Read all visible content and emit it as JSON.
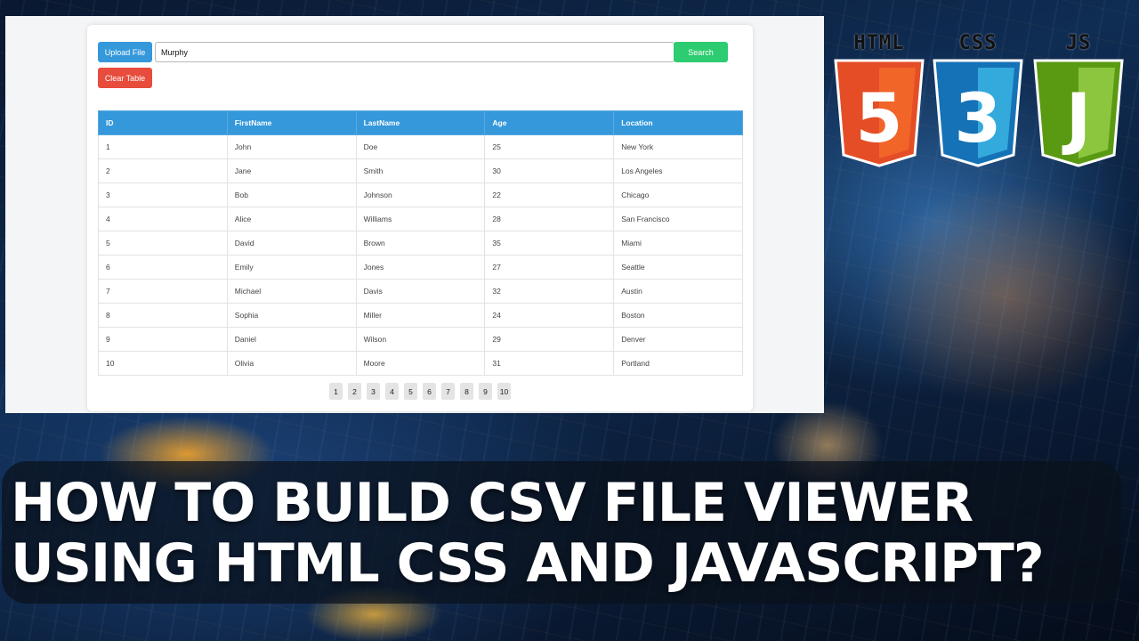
{
  "toolbar": {
    "upload_label": "Upload File",
    "clear_label": "Clear Table",
    "search_label": "Search",
    "search_value": "Murphy"
  },
  "table": {
    "headers": [
      "ID",
      "FirstName",
      "LastName",
      "Age",
      "Location"
    ],
    "rows": [
      [
        "1",
        "John",
        "Doe",
        "25",
        "New York"
      ],
      [
        "2",
        "Jane",
        "Smith",
        "30",
        "Los Angeles"
      ],
      [
        "3",
        "Bob",
        "Johnson",
        "22",
        "Chicago"
      ],
      [
        "4",
        "Alice",
        "Williams",
        "28",
        "San Francisco"
      ],
      [
        "5",
        "David",
        "Brown",
        "35",
        "Miami"
      ],
      [
        "6",
        "Emily",
        "Jones",
        "27",
        "Seattle"
      ],
      [
        "7",
        "Michael",
        "Davis",
        "32",
        "Austin"
      ],
      [
        "8",
        "Sophia",
        "Miller",
        "24",
        "Boston"
      ],
      [
        "9",
        "Daniel",
        "Wilson",
        "29",
        "Denver"
      ],
      [
        "10",
        "Olivia",
        "Moore",
        "31",
        "Portland"
      ]
    ]
  },
  "pagination": {
    "pages": [
      "1",
      "2",
      "3",
      "4",
      "5",
      "6",
      "7",
      "8",
      "9",
      "10"
    ]
  },
  "logos": {
    "html": {
      "label": "HTML",
      "numeral": "5",
      "icon": "html5-shield-icon",
      "color": "#e44d26"
    },
    "css": {
      "label": "CSS",
      "numeral": "3",
      "icon": "css3-shield-icon",
      "color": "#1572b6"
    },
    "js": {
      "label": "JS",
      "numeral": "J",
      "icon": "js-shield-icon",
      "color": "#6aaa1a"
    }
  },
  "title": {
    "line1": "HOW TO BUILD CSV FILE VIEWER",
    "line2": "USING HTML CSS AND JAVASCRIPT?"
  },
  "colors": {
    "upload": "#3498db",
    "clear": "#e74c3c",
    "search": "#2ecc71",
    "table_header": "#3498db"
  }
}
